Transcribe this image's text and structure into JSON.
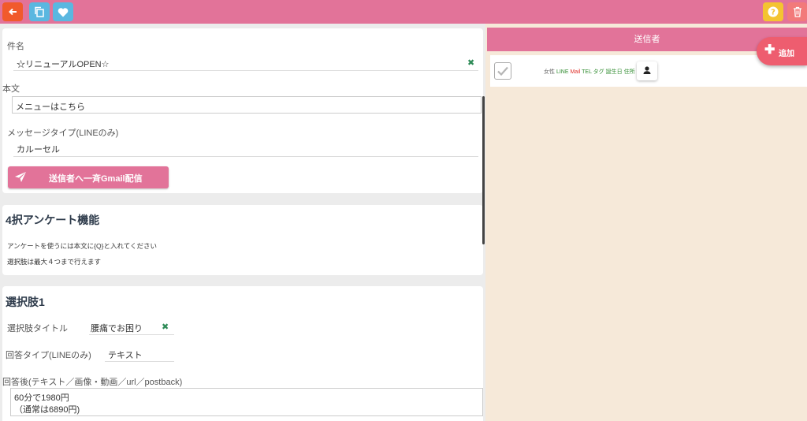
{
  "subject": {
    "label": "件名",
    "value": "☆リニューアルOPEN☆"
  },
  "body": {
    "label": "本文",
    "value": "メニューはこちら"
  },
  "message_type": {
    "label": "メッセージタイプ(LINEのみ)",
    "value": "カルーセル"
  },
  "send_button": {
    "label": "送信者へ一斉Gmail配信"
  },
  "survey": {
    "title": "4択アンケート機能",
    "line1": "アンケートを使うには本文に{Q}と入れてください",
    "line2": "選択肢は最大４つまで行えます"
  },
  "choice1": {
    "title": "選択肢1",
    "choice_title_label": "選択肢タイトル",
    "choice_title_value": "腰痛でお困り",
    "answer_type_label": "回答タイプ(LINEのみ)",
    "answer_type_value": "テキスト",
    "after_answer_label": "回答後(テキスト／画像・動画／url／postback)",
    "after_answer_line1": "60分で1980円",
    "after_answer_line2": "（通常は6890円)"
  },
  "senders": {
    "header": "送信者",
    "add_label": "追加",
    "rows": [
      {
        "gender": "女性",
        "tags": {
          "line": "LINE",
          "mail": "Mail",
          "tel": "TEL",
          "tag": "タグ",
          "birthday": "誕生日",
          "address": "住所"
        }
      }
    ]
  },
  "colors": {
    "accent": "#e27399",
    "back": "#f15a2b",
    "add": "#ee5d6f",
    "panel_bg": "#f6e9d9"
  }
}
